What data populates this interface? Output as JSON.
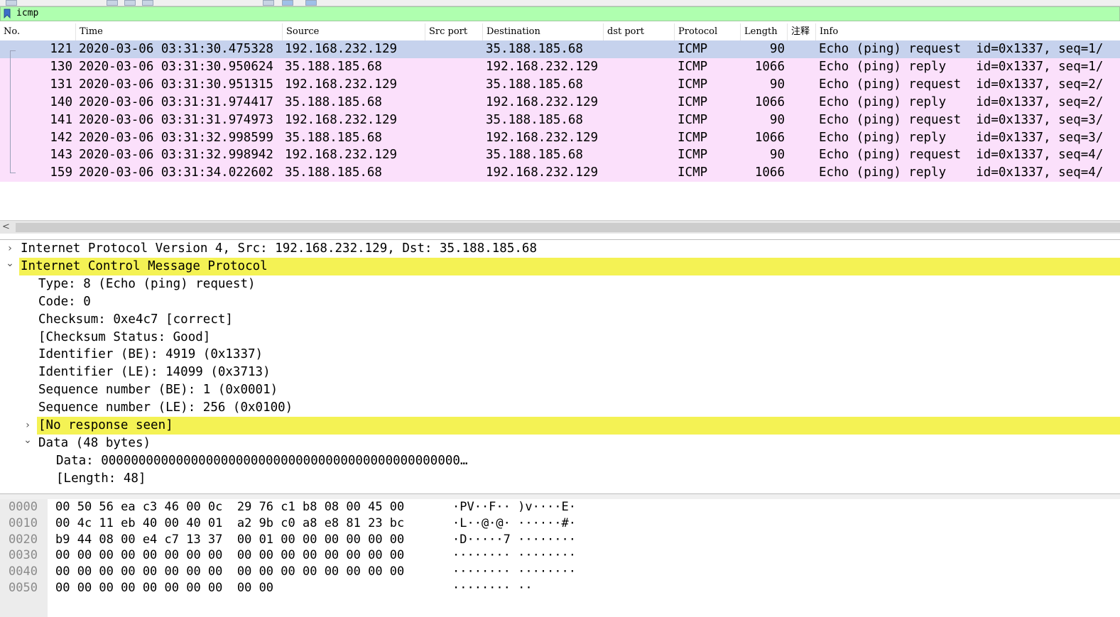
{
  "filter": {
    "text": "icmp"
  },
  "columns": [
    "No.",
    "Time",
    "Source",
    "Src port",
    "Destination",
    "dst port",
    "Protocol",
    "Length",
    "注释",
    "Info"
  ],
  "packets": [
    {
      "no": "121",
      "time": "2020-03-06 03:31:30.475328",
      "src": "192.168.232.129",
      "dst": "35.188.185.68",
      "proto": "ICMP",
      "len": "90",
      "info": "Echo (ping) request  id=0x1337, seq=1/"
    },
    {
      "no": "130",
      "time": "2020-03-06 03:31:30.950624",
      "src": "35.188.185.68",
      "dst": "192.168.232.129",
      "proto": "ICMP",
      "len": "1066",
      "info": "Echo (ping) reply    id=0x1337, seq=1/"
    },
    {
      "no": "131",
      "time": "2020-03-06 03:31:30.951315",
      "src": "192.168.232.129",
      "dst": "35.188.185.68",
      "proto": "ICMP",
      "len": "90",
      "info": "Echo (ping) request  id=0x1337, seq=2/"
    },
    {
      "no": "140",
      "time": "2020-03-06 03:31:31.974417",
      "src": "35.188.185.68",
      "dst": "192.168.232.129",
      "proto": "ICMP",
      "len": "1066",
      "info": "Echo (ping) reply    id=0x1337, seq=2/"
    },
    {
      "no": "141",
      "time": "2020-03-06 03:31:31.974973",
      "src": "192.168.232.129",
      "dst": "35.188.185.68",
      "proto": "ICMP",
      "len": "90",
      "info": "Echo (ping) request  id=0x1337, seq=3/"
    },
    {
      "no": "142",
      "time": "2020-03-06 03:31:32.998599",
      "src": "35.188.185.68",
      "dst": "192.168.232.129",
      "proto": "ICMP",
      "len": "1066",
      "info": "Echo (ping) reply    id=0x1337, seq=3/"
    },
    {
      "no": "143",
      "time": "2020-03-06 03:31:32.998942",
      "src": "192.168.232.129",
      "dst": "35.188.185.68",
      "proto": "ICMP",
      "len": "90",
      "info": "Echo (ping) request  id=0x1337, seq=4/"
    },
    {
      "no": "159",
      "time": "2020-03-06 03:31:34.022602",
      "src": "35.188.185.68",
      "dst": "192.168.232.129",
      "proto": "ICMP",
      "len": "1066",
      "info": "Echo (ping) reply    id=0x1337, seq=4/"
    }
  ],
  "selected_packet": "121",
  "details": [
    {
      "text": "Internet Protocol Version 4, Src: 192.168.232.129, Dst: 35.188.185.68",
      "indent": 0,
      "expander": "collapsed",
      "highlight": false
    },
    {
      "text": "Internet Control Message Protocol",
      "indent": 0,
      "expander": "expanded",
      "highlight": true
    },
    {
      "text": "Type: 8 (Echo (ping) request)",
      "indent": 1,
      "expander": "none",
      "highlight": false
    },
    {
      "text": "Code: 0",
      "indent": 1,
      "expander": "none",
      "highlight": false
    },
    {
      "text": "Checksum: 0xe4c7 [correct]",
      "indent": 1,
      "expander": "none",
      "highlight": false
    },
    {
      "text": "[Checksum Status: Good]",
      "indent": 1,
      "expander": "none",
      "highlight": false
    },
    {
      "text": "Identifier (BE): 4919 (0x1337)",
      "indent": 1,
      "expander": "none",
      "highlight": false
    },
    {
      "text": "Identifier (LE): 14099 (0x3713)",
      "indent": 1,
      "expander": "none",
      "highlight": false
    },
    {
      "text": "Sequence number (BE): 1 (0x0001)",
      "indent": 1,
      "expander": "none",
      "highlight": false
    },
    {
      "text": "Sequence number (LE): 256 (0x0100)",
      "indent": 1,
      "expander": "none",
      "highlight": false
    },
    {
      "text": "[No response seen]",
      "indent": 1,
      "expander": "collapsed",
      "highlight": true
    },
    {
      "text": "Data (48 bytes)",
      "indent": 1,
      "expander": "expanded",
      "highlight": false
    },
    {
      "text": "Data: 000000000000000000000000000000000000000000000000…",
      "indent": 2,
      "expander": "none",
      "highlight": false
    },
    {
      "text": "[Length: 48]",
      "indent": 2,
      "expander": "none",
      "highlight": false
    }
  ],
  "bytes": [
    {
      "offset": "0000",
      "hex": "00 50 56 ea c3 46 00 0c  29 76 c1 b8 08 00 45 00",
      "ascii": "·PV··F·· )v····E·"
    },
    {
      "offset": "0010",
      "hex": "00 4c 11 eb 40 00 40 01  a2 9b c0 a8 e8 81 23 bc",
      "ascii": "·L··@·@· ······#·"
    },
    {
      "offset": "0020",
      "hex": "b9 44 08 00 e4 c7 13 37  00 01 00 00 00 00 00 00",
      "ascii": "·D·····7 ········"
    },
    {
      "offset": "0030",
      "hex": "00 00 00 00 00 00 00 00  00 00 00 00 00 00 00 00",
      "ascii": "········ ········"
    },
    {
      "offset": "0040",
      "hex": "00 00 00 00 00 00 00 00  00 00 00 00 00 00 00 00",
      "ascii": "········ ········"
    },
    {
      "offset": "0050",
      "hex": "00 00 00 00 00 00 00 00  00 00",
      "ascii": "········ ··"
    }
  ],
  "colors": {
    "filter_valid": "#afffaf",
    "icmp_row": "#fbe0fb",
    "selected_row": "#c6d2ed",
    "field_highlight": "#f4f254"
  }
}
